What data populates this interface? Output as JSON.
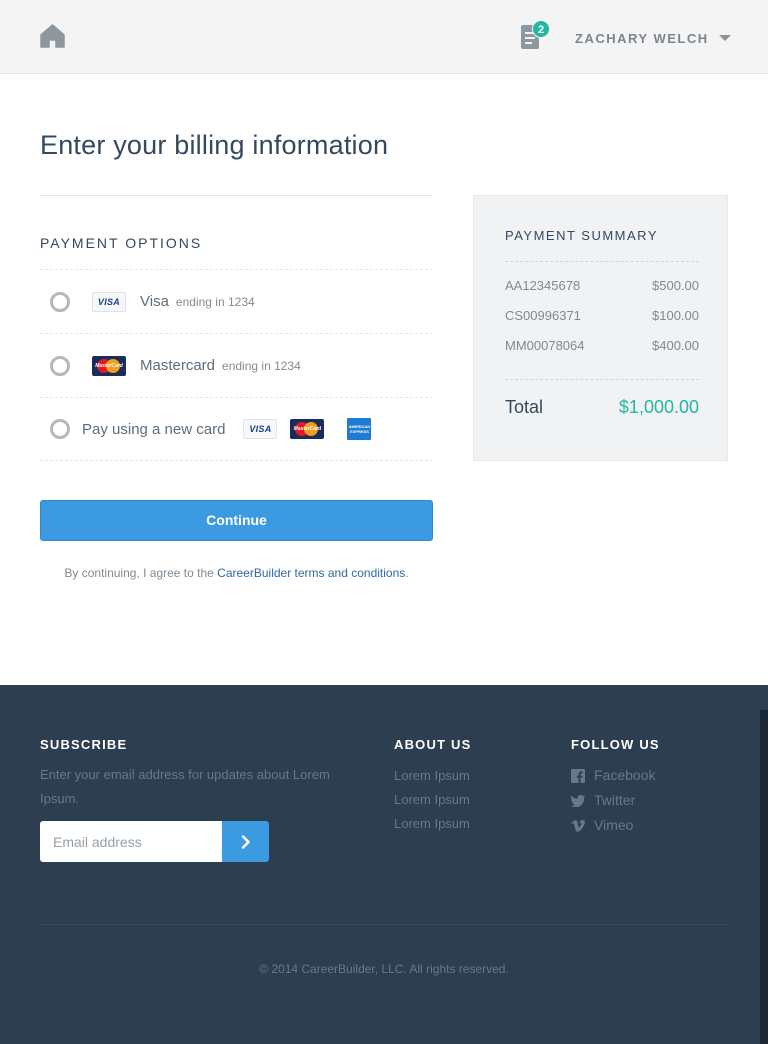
{
  "header": {
    "notification_count": "2",
    "user_name": "ZACHARY WELCH"
  },
  "main": {
    "title": "Enter your billing information",
    "payment_options_heading": "PAYMENT OPTIONS",
    "options": [
      {
        "name": "Visa",
        "detail": "ending in 1234",
        "icon": "visa-card-icon"
      },
      {
        "name": "Mastercard",
        "detail": "ending in 1234",
        "icon": "mastercard-icon"
      },
      {
        "name": "Pay using a new card",
        "icons": [
          "visa-card-icon",
          "mastercard-icon",
          "amex-card-icon"
        ]
      }
    ],
    "card_visa_text": "VISA",
    "card_mc_text": "MasterCard",
    "card_amex_text": "AMERICAN EXPRESS",
    "continue_label": "Continue",
    "terms_prefix": "By continuing, I agree to the",
    "terms_link": "CareerBuilder terms and conditions",
    "terms_suffix": "."
  },
  "summary": {
    "heading": "PAYMENT SUMMARY",
    "items": [
      {
        "id": "AA12345678",
        "amount": "$500.00"
      },
      {
        "id": "CS00996371",
        "amount": "$100.00"
      },
      {
        "id": "MM00078064",
        "amount": "$400.00"
      }
    ],
    "total_label": "Total",
    "total_value": "$1,000.00"
  },
  "footer": {
    "subscribe_heading": "SUBSCRIBE",
    "subscribe_desc": "Enter your email address for updates about Lorem Ipsum.",
    "email_placeholder": "Email address",
    "about_heading": "ABOUT US",
    "about_links": [
      "Lorem Ipsum",
      "Lorem Ipsum",
      "Lorem Ipsum"
    ],
    "follow_heading": "FOLLOW US",
    "social": [
      {
        "label": "Facebook",
        "icon": "facebook-icon"
      },
      {
        "label": "Twitter",
        "icon": "twitter-icon"
      },
      {
        "label": "Vimeo",
        "icon": "vimeo-icon"
      }
    ],
    "copyright": "© 2014 CareerBuilder, LLC. All rights reserved."
  },
  "colors": {
    "accent_blue": "#3c9ae0",
    "accent_teal": "#22b7a0",
    "footer_bg": "#2c3e50",
    "header_bg": "#f4f4f4"
  }
}
